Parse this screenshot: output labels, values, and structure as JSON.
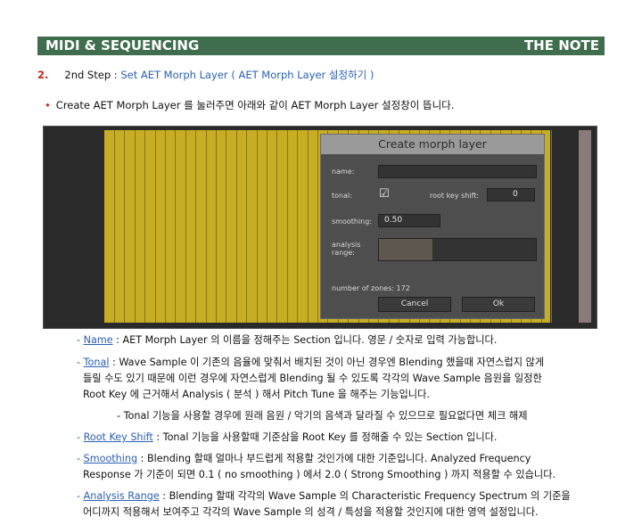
{
  "header": {
    "left": "MIDI & SEQUENCING",
    "right": "THE NOTE"
  },
  "step": {
    "number": "2.",
    "prefix": "2nd Step :",
    "title": "Set AET Morph Layer ( AET Morph Layer 설정하기 )"
  },
  "intro": "Create AET Morph Layer 를 눌러주면 아래와 같이 AET Morph Layer 설정창이 뜹니다.",
  "dialog": {
    "title": "Create morph layer",
    "name_label": "name:",
    "tonal_label": "tonal:",
    "tonal_checked": "☑",
    "root_key_shift_label": "root key shift:",
    "root_key_shift_value": "0",
    "smoothing_label": "smoothing:",
    "smoothing_value": "0.50",
    "analysis_range_label_1": "analysis",
    "analysis_range_label_2": "range:",
    "zones": "number of zones: 172",
    "cancel": "Cancel",
    "ok": "Ok"
  },
  "items": [
    {
      "term": "Name",
      "lines": [
        " : AET Morph Layer 의 이름을 정해주는 Section 입니다. 영문 / 숫자로 입력 가능합니다."
      ]
    },
    {
      "term": "Tonal",
      "lines": [
        " : Wave Sample 이 기존의 음율에 맞춰서 배치된 것이 아닌 경우엔 Blending 했을때 자연스럽지 않게",
        "들릴 수도 있기 때문에 이런 경우에 자연스럽게 Blending 될 수 있도록 각각의 Wave Sample 음원을 일정한",
        "Root Key 에 근거해서 Analysis ( 분석 ) 해서 Pitch Tune 을 해주는 기능입니다."
      ]
    },
    {
      "sub": "- Tonal 기능을 사용할 경우에 원래 음원 / 악기의 음색과 달라질 수 있으므로 필요없다면 체크 해제"
    },
    {
      "term": "Root Key Shift",
      "lines": [
        " : Tonal 기능을 사용할때 기준삼을 Root Key 를 정해줄 수 있는 Section 입니다."
      ]
    },
    {
      "term": "Smoothing",
      "lines": [
        " : Blending 할때 얼마나 부드럽게 적용할 것인가에 대한 기준입니다. Analyzed Frequency",
        "Response 가 기준이 되면 0.1 ( no smoothing ) 에서 2.0 ( Strong Smoothing ) 까지 적용할 수 있습니다."
      ]
    },
    {
      "term": "Analysis Range",
      "lines": [
        " : Blending 할때 각각의 Wave Sample 의 Characteristic Frequency Spectrum 의 기준을",
        "어디까지 적용해서 보여주고 각각의 Wave Sample 의 성격 / 특성을 적용할 것인지에 대한 영역 설정입니다."
      ]
    }
  ]
}
